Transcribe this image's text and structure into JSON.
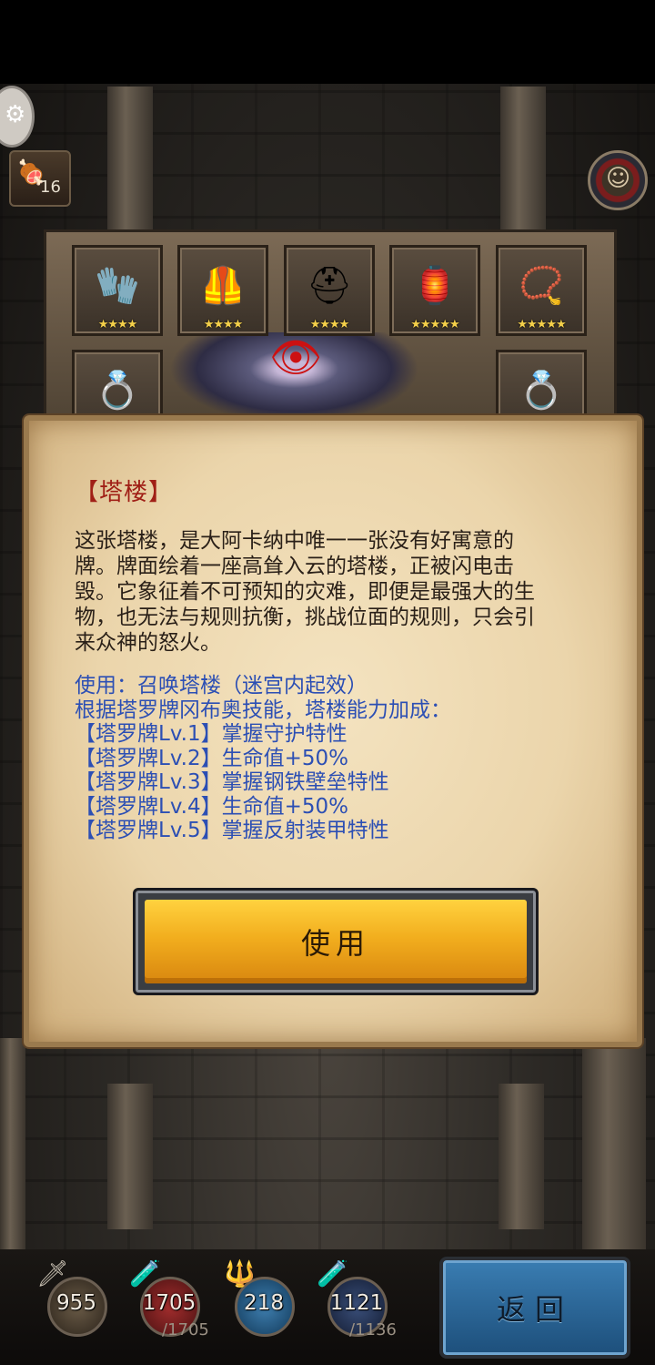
{
  "hud": {
    "food_count": "16",
    "settings_icon": "gear-icon",
    "portrait_icon": "hero-portrait-icon"
  },
  "card_board": {
    "slots": [
      {
        "name": "gauntlet",
        "glyph": "🧤",
        "stars": "★★★★"
      },
      {
        "name": "armor",
        "glyph": "🦺",
        "stars": "★★★★"
      },
      {
        "name": "helmet",
        "glyph": "⛑",
        "stars": "★★★★"
      },
      {
        "name": "lamp",
        "glyph": "🏮",
        "stars": "★★★★★"
      },
      {
        "name": "amulet",
        "glyph": "📿",
        "stars": "★★★★★"
      },
      {
        "name": "bracelet",
        "glyph": "💍",
        "stars": ""
      },
      {
        "name": "ring",
        "glyph": "💍",
        "stars": ""
      }
    ]
  },
  "dialog": {
    "title": "【塔楼】",
    "description": "这张塔楼，是大阿卡纳中唯一一张没有好寓意的牌。牌面绘着一座高耸入云的塔楼，正被闪电击毁。它象征着不可预知的灾难，即便是最强大的生物，也无法与规则抗衡，挑战位面的规则，只会引来众神的怒火。",
    "usage_lines": [
      "使用：召唤塔楼（迷宫内起效）",
      "根据塔罗牌冈布奥技能，塔楼能力加成：",
      "【塔罗牌Lv.1】掌握守护特性",
      "【塔罗牌Lv.2】生命值+50%",
      "【塔罗牌Lv.3】掌握钢铁壁垒特性",
      "【塔罗牌Lv.4】生命值+50%",
      "【塔罗牌Lv.5】掌握反射装甲特性"
    ],
    "use_button_label": "使用"
  },
  "stats": {
    "attack": {
      "value": "955",
      "icon": "sword-icon"
    },
    "hp": {
      "value": "1705",
      "max": "/1705",
      "icon": "heart-potion-icon"
    },
    "magic": {
      "value": "218",
      "icon": "staff-icon"
    },
    "mp": {
      "value": "1121",
      "max": "/1136",
      "icon": "mana-potion-icon"
    }
  },
  "back_button_label": "返回",
  "colors": {
    "title_red": "#a01f16",
    "usage_blue": "#2c4fb4",
    "button_gold": "#f2ae1e",
    "back_blue": "#2d6fa5"
  }
}
